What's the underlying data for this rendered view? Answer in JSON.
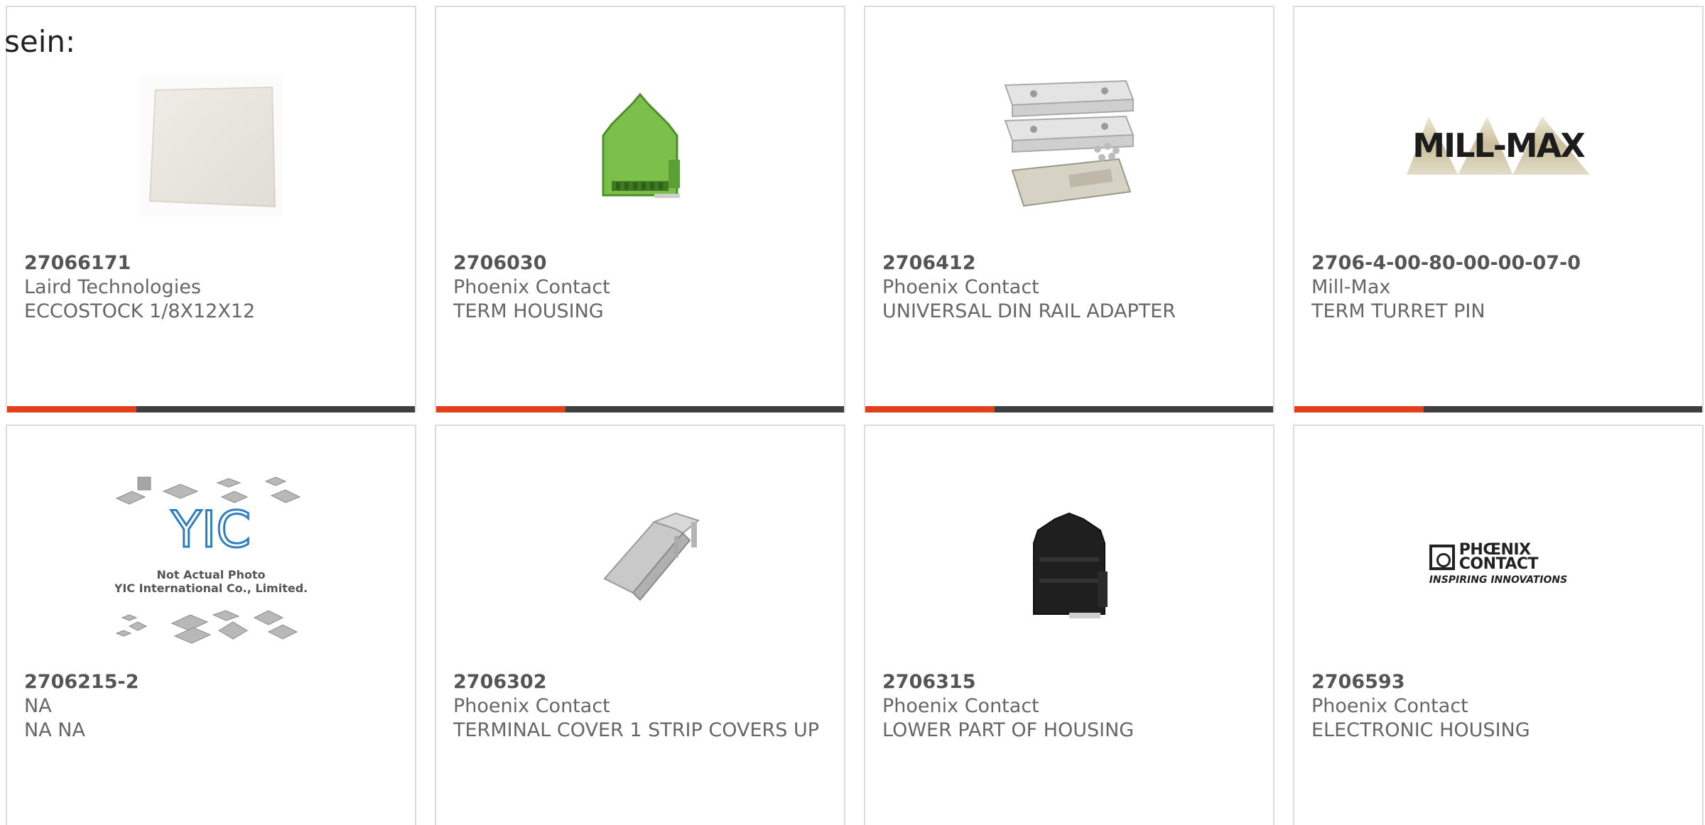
{
  "intro_text": "sein:",
  "colors": {
    "accent": "#e2401c",
    "bar": "#3f3f3f",
    "border": "#dcdcdc",
    "text": "#666666"
  },
  "products": [
    {
      "part_number": "27066171",
      "manufacturer": "Laird Technologies",
      "description": "ECCOSTOCK 1/8X12X12",
      "image": "foam-sheet-image"
    },
    {
      "part_number": "2706030",
      "manufacturer": "Phoenix Contact",
      "description": "TERM HOUSING",
      "image": "green-din-housing-image"
    },
    {
      "part_number": "2706412",
      "manufacturer": "Phoenix Contact",
      "description": "UNIVERSAL DIN RAIL ADAPTER",
      "image": "din-rail-adapter-image"
    },
    {
      "part_number": "2706-4-00-80-00-00-07-0",
      "manufacturer": "Mill-Max",
      "description": "TERM TURRET PIN",
      "image": "mill-max-logo",
      "logo_text": "MILL-MAX"
    },
    {
      "part_number": "2706215-2",
      "manufacturer": "NA",
      "description": "NA NA",
      "image": "yic-placeholder-image",
      "placeholder_line1": "Not Actual Photo",
      "placeholder_line2": "YIC International Co., Limited.",
      "placeholder_logo": "YIC"
    },
    {
      "part_number": "2706302",
      "manufacturer": "Phoenix Contact",
      "description": "TERMINAL COVER 1 STRIP COVERS UP",
      "image": "terminal-cover-image"
    },
    {
      "part_number": "2706315",
      "manufacturer": "Phoenix Contact",
      "description": "LOWER PART OF HOUSING",
      "image": "black-housing-image"
    },
    {
      "part_number": "2706593",
      "manufacturer": "Phoenix Contact",
      "description": "ELECTRONIC HOUSING",
      "image": "phoenix-contact-logo",
      "logo_line1": "PHŒNIX",
      "logo_line2": "CONTACT",
      "logo_tagline": "INSPIRING INNOVATIONS"
    }
  ]
}
